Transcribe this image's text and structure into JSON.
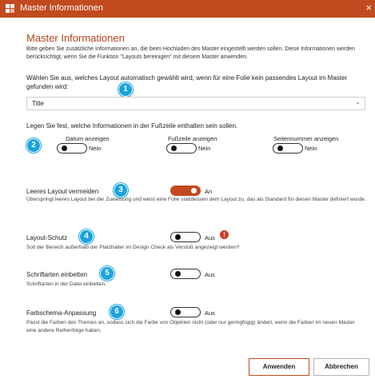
{
  "window": {
    "title": "Master Informationen",
    "close": "×"
  },
  "heading": "Master Informationen",
  "intro": "Bitte geben Sie zusätzliche Informationen an, die beim Hochladen des Master eingestellt werden sollen. Diese Informationen werden berücksichtigt, wenn Sie die Funktion \"Layouts bereinigen\" mit diesem Master anwenden.",
  "layout": {
    "label": "Wählen Sie aus, welches Layout automatisch gewählt wird, wenn für eine Folie kein passendes Layout im Master gefunden wird:",
    "selected": "Title",
    "badge": "1"
  },
  "footer": {
    "label": "Legen Sie fest, welche Informationen in der Fußzeile enthalten sein sollen.",
    "badge": "2",
    "date": {
      "label": "Datum anzeigen",
      "state": "Nein"
    },
    "footer_line": {
      "label": "Fußzeile anzeigen",
      "state": "Nein"
    },
    "page_number": {
      "label": "Seitennummer anzeigen",
      "state": "Nein"
    }
  },
  "empty_layout": {
    "label": "Leeres Layout vermeiden",
    "badge": "3",
    "state": "An",
    "desc": "Überspringt leeres Layout bei der Zuweisung und weist eine Folie stattdessen dem Layout zu, das als Standard für diesen Master definiert wurde."
  },
  "layout_protection": {
    "label": "Layout-Schutz",
    "badge": "4",
    "state": "Aus",
    "warning": "!",
    "desc": "Soll der Bereich außerhalb der Platzhalter im Design Check als Verstoß angezeigt werden?"
  },
  "embed_fonts": {
    "label": "Schriftarten einbetten",
    "badge": "5",
    "state": "Aus",
    "desc": "Schriftarten in der Datei einbetten."
  },
  "color_scheme": {
    "label": "Farbschema-Anpassung",
    "badge": "6",
    "state": "Aus",
    "desc": "Passt die Farben des Themes an, sodass sich die Farbe von Objekten nicht (oder nur geringfügig) ändert, wenn die Farben im neuen Master eine andere Reihenfolge haben."
  },
  "buttons": {
    "apply": "Anwenden",
    "cancel": "Abbrechen"
  },
  "colors": {
    "accent": "#c24a1f",
    "badge": "#1aa3dc",
    "warning": "#d23a2a"
  },
  "icons": {
    "app": "app-grid-icon",
    "dropdown": "chevron-down-icon",
    "warning": "warning-icon"
  }
}
